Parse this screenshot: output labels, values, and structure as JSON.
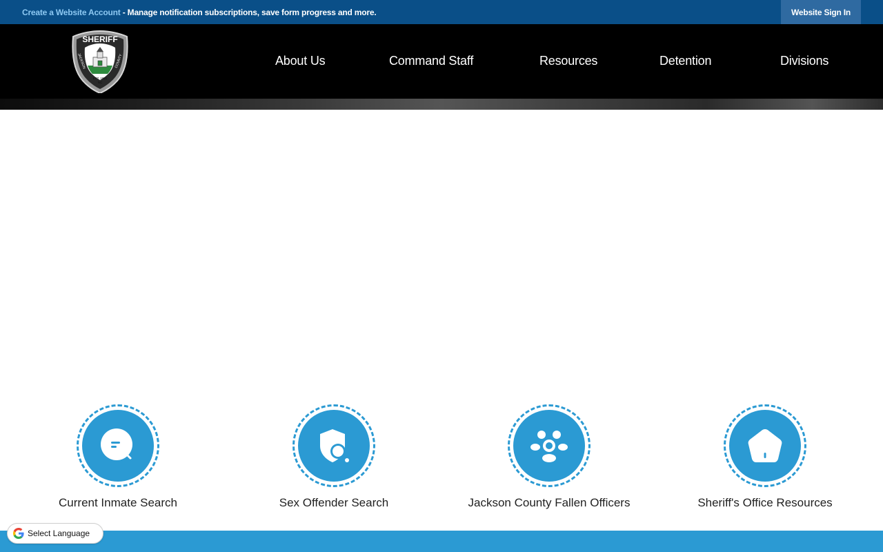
{
  "topbar": {
    "create_link": "Create a Website Account",
    "message": " - Manage notification subscriptions, save form progress and more.",
    "signin_label": "Website Sign In"
  },
  "logo": {
    "top_text": "SHERIFF",
    "left_text": "JACKSON",
    "right_text": "COUNTY",
    "est_text": "EST. 1851",
    "state_text": "NC"
  },
  "nav": {
    "items": [
      {
        "label": "About Us"
      },
      {
        "label": "Command Staff"
      },
      {
        "label": "Resources"
      },
      {
        "label": "Detention"
      },
      {
        "label": "Divisions"
      }
    ]
  },
  "quick_links": [
    {
      "label": "Current Inmate Search",
      "icon": "inmate-search-icon"
    },
    {
      "label": "Sex Offender Search",
      "icon": "offender-search-icon"
    },
    {
      "label": "Jackson County Fallen Officers",
      "icon": "people-group-icon"
    },
    {
      "label": "Sheriff's Office Resources",
      "icon": "house-icon"
    }
  ],
  "translate": {
    "label": "Select Language",
    "icon": "google-g-icon"
  },
  "colors": {
    "topbar": "#0a4f88",
    "create_link": "#8cc8f2",
    "signin_button": "#2f6aa1",
    "header": "#000000",
    "accent": "#2b9ad3"
  }
}
